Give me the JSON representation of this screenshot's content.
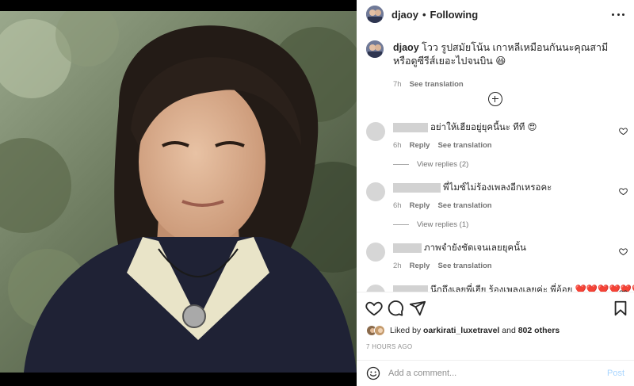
{
  "post_user": {
    "username": "djaoy",
    "separator": "•",
    "follow_status": "Following"
  },
  "caption": {
    "username": "djaoy",
    "text": "โวว รูปสมัยโน้น เกาหลีเหมือนกันนะคุณสามี หรือดูซีรีส์เยอะไปจนบิน 😆",
    "time": "7h",
    "see_translation": "See translation"
  },
  "comments": [
    {
      "text": "อย่าให้เฮียอยู่ยุคนี้นะ ทีที 😍",
      "time": "6h",
      "reply_label": "Reply",
      "see_translation": "See translation",
      "view_replies": "View replies (2)"
    },
    {
      "text": "พี่ไมซ์ไม่ร้องเพลงอีกเหรอคะ",
      "time": "6h",
      "reply_label": "Reply",
      "see_translation": "See translation",
      "view_replies": "View replies (1)"
    },
    {
      "text": "ภาพจำยังชัดเจนเลยยุคนั้น",
      "time": "2h",
      "reply_label": "Reply",
      "see_translation": "See translation"
    },
    {
      "text": "นึกถึงเลยพี่เฮีย ร้องเพลงเลยค่ะ พี่อ้อย ❤️❤️❤️❤️❤️❤️"
    }
  ],
  "likes": {
    "prefix": "Liked by",
    "user": "oarkirati_luxetravel",
    "joiner": "and",
    "others": "802 others"
  },
  "timestamp": "7 HOURS AGO",
  "add_comment": {
    "placeholder": "Add a comment...",
    "post_label": "Post"
  },
  "colors": {
    "link_blue": "#0095f6",
    "post_disabled": "#a8d5ff",
    "secondary_text": "#8e8e8e"
  }
}
